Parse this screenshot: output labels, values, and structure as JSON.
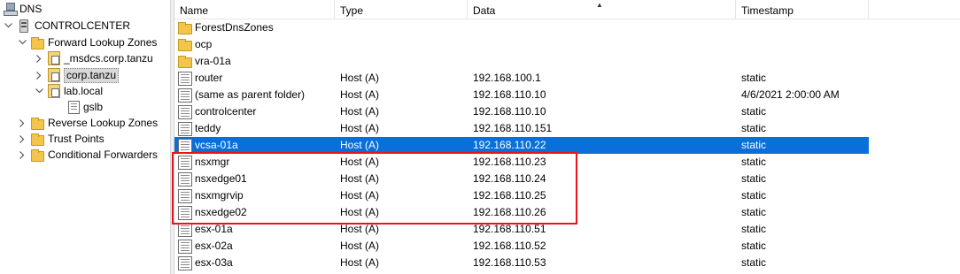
{
  "tree": {
    "root": {
      "label": "DNS",
      "icon": "dns-icon"
    },
    "server": {
      "label": "CONTROLCENTER",
      "icon": "server-icon"
    },
    "forward": {
      "label": "Forward Lookup Zones",
      "icon": "folder-icon"
    },
    "msdcs": {
      "label": "_msdcs.corp.tanzu",
      "icon": "zone-icon"
    },
    "corp": {
      "label": "corp.tanzu",
      "icon": "zone-icon"
    },
    "lab": {
      "label": "lab.local",
      "icon": "zone-icon"
    },
    "gslb": {
      "label": "gslb",
      "icon": "record-icon"
    },
    "reverse": {
      "label": "Reverse Lookup Zones",
      "icon": "folder-icon"
    },
    "trust": {
      "label": "Trust Points",
      "icon": "folder-icon"
    },
    "conditional": {
      "label": "Conditional Forwarders",
      "icon": "folder-icon"
    }
  },
  "columns": {
    "name": "Name",
    "type": "Type",
    "data": "Data",
    "timestamp": "Timestamp"
  },
  "rows": [
    {
      "name": "ForestDnsZones",
      "type": "",
      "data": "",
      "timestamp": "",
      "icon": "folder-icon"
    },
    {
      "name": "ocp",
      "type": "",
      "data": "",
      "timestamp": "",
      "icon": "folder-icon"
    },
    {
      "name": "vra-01a",
      "type": "",
      "data": "",
      "timestamp": "",
      "icon": "folder-icon"
    },
    {
      "name": "router",
      "type": "Host (A)",
      "data": "192.168.100.1",
      "timestamp": "static",
      "icon": "record-icon"
    },
    {
      "name": "(same as parent folder)",
      "type": "Host (A)",
      "data": "192.168.110.10",
      "timestamp": "4/6/2021 2:00:00 AM",
      "icon": "record-icon"
    },
    {
      "name": "controlcenter",
      "type": "Host (A)",
      "data": "192.168.110.10",
      "timestamp": "static",
      "icon": "record-icon"
    },
    {
      "name": "teddy",
      "type": "Host (A)",
      "data": "192.168.110.151",
      "timestamp": "static",
      "icon": "record-icon"
    },
    {
      "name": "vcsa-01a",
      "type": "Host (A)",
      "data": "192.168.110.22",
      "timestamp": "static",
      "icon": "record-icon",
      "selected": true
    },
    {
      "name": "nsxmgr",
      "type": "Host (A)",
      "data": "192.168.110.23",
      "timestamp": "static",
      "icon": "record-icon"
    },
    {
      "name": "nsxedge01",
      "type": "Host (A)",
      "data": "192.168.110.24",
      "timestamp": "static",
      "icon": "record-icon"
    },
    {
      "name": "nsxmgrvip",
      "type": "Host (A)",
      "data": "192.168.110.25",
      "timestamp": "static",
      "icon": "record-icon"
    },
    {
      "name": "nsxedge02",
      "type": "Host (A)",
      "data": "192.168.110.26",
      "timestamp": "static",
      "icon": "record-icon"
    },
    {
      "name": "esx-01a",
      "type": "Host (A)",
      "data": "192.168.110.51",
      "timestamp": "static",
      "icon": "record-icon"
    },
    {
      "name": "esx-02a",
      "type": "Host (A)",
      "data": "192.168.110.52",
      "timestamp": "static",
      "icon": "record-icon"
    },
    {
      "name": "esx-03a",
      "type": "Host (A)",
      "data": "192.168.110.53",
      "timestamp": "static",
      "icon": "record-icon"
    }
  ],
  "colors": {
    "selection": "#0a6fd8",
    "highlight": "#e8141c"
  }
}
